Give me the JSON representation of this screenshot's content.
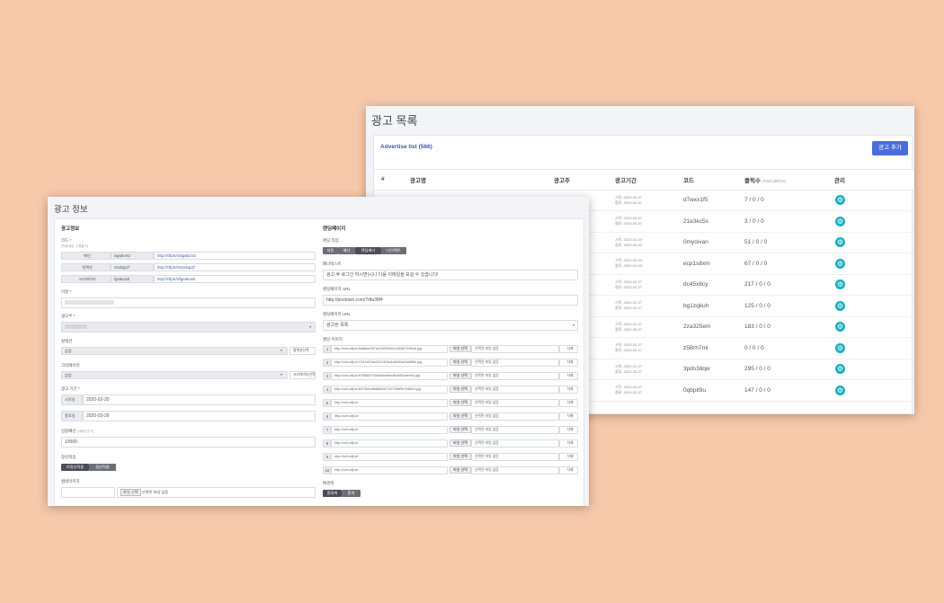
{
  "list": {
    "title": "광고 목록",
    "card_title": "Advertise list (566)",
    "add_button": "광고 추가",
    "columns": [
      "#",
      "광고명",
      "광고주",
      "광고기간",
      "코드",
      "클릭수"
    ],
    "clicks_sub": "(Tot/Coll/Cre)",
    "manage_col": "관리",
    "rows": [
      {
        "start": "시작: 2020-03-07",
        "end": "종료: 2020-04-07",
        "code": "d7wxx1f5",
        "clicks": "7 / 0 / 0"
      },
      {
        "start": "시작: 2020-03-07",
        "end": "종료: 2020-04-07",
        "code": "21e3kc5s",
        "clicks": "3 / 0 / 0"
      },
      {
        "start": "시작: 2020-03-03",
        "end": "종료: 2020-04-03",
        "code": "0myoivan",
        "clicks": "51 / 0 / 0"
      },
      {
        "start": "시작: 2020-03-03",
        "end": "종료: 2020-04-03",
        "code": "ecp1s8xm",
        "clicks": "67 / 0 / 0"
      },
      {
        "start": "시작: 2020-02-27",
        "end": "종료: 2020-03-27",
        "code": "dc45x8cy",
        "clicks": "217 / 0 / 0"
      },
      {
        "start": "시작: 2020-02-27",
        "end": "종료: 2020-03-27",
        "code": "bg1zqkuh",
        "clicks": "125 / 0 / 0"
      },
      {
        "start": "시작: 2020-02-27",
        "end": "종료: 2020-03-27",
        "code": "2za325em",
        "clicks": "183 / 0 / 0"
      },
      {
        "start": "시작: 2020-02-27",
        "end": "종료: 2020-03-27",
        "code": "z5Brh7ml",
        "clicks": "0 / 0 / 0"
      },
      {
        "start": "시작: 2020-02-27",
        "end": "종료: 2020-03-27",
        "code": "3pds3dqw",
        "clicks": "295 / 0 / 0"
      },
      {
        "start": "시작: 2020-02-27",
        "end": "종료: 2020-03-27",
        "code": "0qbpit9u",
        "clicks": "147 / 0 / 0"
      }
    ]
  },
  "form": {
    "title": "광고 정보",
    "info_section": "광고정보",
    "code_label": "코드 *",
    "code_hint": "(자동생성, 수정불가)",
    "codes": [
      {
        "name": "메인",
        "code": "isgwkzmz",
        "url": "http://sftj.kr/s/isgwkzmz"
      },
      {
        "name": "컬렉션",
        "code": "n2xkqy2f",
        "url": "http://sftj.kr/s/n2xkqy2f"
      },
      {
        "name": "크리에이터",
        "code": "fge8uox0",
        "url": "http://sftj.kr/s/fge8uox0"
      }
    ],
    "name_label": "이름 *",
    "advertiser_label": "광고주 *",
    "collection_label": "컬렉션",
    "collection_value": "없음",
    "collection_select_label": "컬렉션선택",
    "creator_label": "크리에이터",
    "creator_value": "없음",
    "creator_select_label": "크리에이터선택",
    "period_label": "광고 기간 *",
    "start_label": "시작일",
    "start_value": "2020-02-20",
    "end_label": "종료일",
    "end_value": "2020-03-26",
    "budget_label": "입찰예산",
    "budget_hint": "(1회당 단가)",
    "budget_value": "10000",
    "apply_label": "정산적용",
    "apply_buttons": [
      "미정산적용",
      "정산적용"
    ],
    "thumb_label": "썸네이미지",
    "file_button": "파일 선택",
    "file_empty": "선택된 파일 없음",
    "landing_section": "랜딩페이지",
    "landing_type_label": "랜딩 타입",
    "landing_types": [
      "자동",
      "배너",
      "랜딩배너",
      "다이렉트"
    ],
    "banner_text_label": "배너텍스트",
    "banner_text_value": "광고 후 로그인 하시면(+)나 다음 이메일을 보실 수 있습니다!",
    "landing_url_label": "랜딩페이지 URL",
    "landing_url_value": "http://postown.com/7dfa38f4",
    "landing_url2_label": "랜딩페이지 URL",
    "landing_url2_value": "광고된 목록",
    "image_label": "랜딩 이미지",
    "image_rows": [
      {
        "idx": "1",
        "url": "http://cdn.sftj.kr/3dd8de257a312ff354b2c2b3d070f60d.jpg",
        "file": "파일 선택",
        "status": "선택된 파일 없음",
        "del": "삭제"
      },
      {
        "idx": "2",
        "url": "http://cdn.sftj.kr/7237d97ae2312405a1e6004a1faff954.jpg",
        "file": "파일 선택",
        "status": "선택된 파일 없음",
        "del": "삭제"
      },
      {
        "idx": "3",
        "url": "http://cdn.sftj.kr/97f0669792b8ddc8eed84d909aee9d.jpg",
        "file": "파일 선택",
        "status": "선택된 파일 없음",
        "del": "삭제"
      },
      {
        "idx": "4",
        "url": "http://cdn.sftj.kr/837364d8fa88a287347285f5b7b8324.jpg",
        "file": "파일 선택",
        "status": "선택된 파일 없음",
        "del": "삭제"
      },
      {
        "idx": "5",
        "url": "http://cdn.sftj.kr/",
        "file": "파일 선택",
        "status": "선택된 파일 없음",
        "del": "삭제"
      },
      {
        "idx": "6",
        "url": "http://cdn.sftj.kr/",
        "file": "파일 선택",
        "status": "선택된 파일 없음",
        "del": "삭제"
      },
      {
        "idx": "7",
        "url": "http://cdn.sftj.kr/",
        "file": "파일 선택",
        "status": "선택된 파일 없음",
        "del": "삭제"
      },
      {
        "idx": "8",
        "url": "http://cdn.sftj.kr/",
        "file": "파일 선택",
        "status": "선택된 파일 없음",
        "del": "삭제"
      },
      {
        "idx": "9",
        "url": "http://cdn.sftj.kr/",
        "file": "파일 선택",
        "status": "선택된 파일 없음",
        "del": "삭제"
      },
      {
        "idx": "10",
        "url": "http://cdn.sftj.kr/",
        "file": "파일 선택",
        "status": "선택된 파일 없음",
        "del": "삭제"
      }
    ],
    "bg_label": "배경색",
    "bg_buttons": [
      "흰화색",
      "흰색"
    ]
  }
}
